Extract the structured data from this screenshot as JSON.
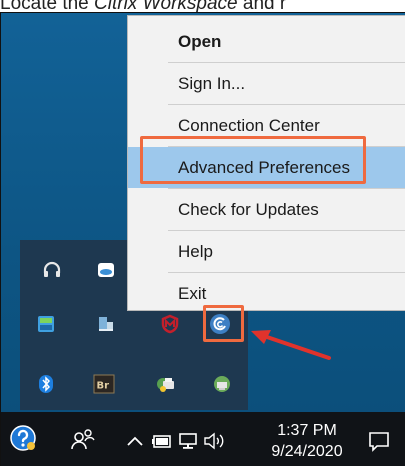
{
  "caption": {
    "prefix": "Locate the ",
    "emphasis": "Citrix Workspace",
    "suffix": " and r"
  },
  "context_menu": {
    "items": [
      {
        "label": "Open",
        "bold": true
      },
      {
        "label": "Sign In..."
      },
      {
        "label": "Connection Center"
      },
      {
        "label": "Advanced Preferences",
        "highlighted": true
      },
      {
        "label": "Check for Updates"
      },
      {
        "label": "Help"
      },
      {
        "label": "Exit"
      }
    ]
  },
  "tray_flyout": {
    "icons": [
      "headset-icon",
      "cloud-icon",
      "system-monitor-icon",
      "storage-icon",
      "mcafee-icon",
      "citrix-workspace-icon",
      "bluetooth-icon",
      "adobe-bridge-icon",
      "printer-icon",
      "network-icon"
    ]
  },
  "taskbar": {
    "time": "1:37 PM",
    "date": "9/24/2020",
    "icons": [
      "help-icon",
      "people-icon",
      "chevron-up-icon",
      "battery-icon",
      "network-icon",
      "volume-icon",
      "notification-icon"
    ]
  },
  "colors": {
    "menu_highlight": "#9dc8ec",
    "callout_orange": "#ef6a3f",
    "arrow_red": "#e0332c",
    "taskbar": "#101317"
  }
}
